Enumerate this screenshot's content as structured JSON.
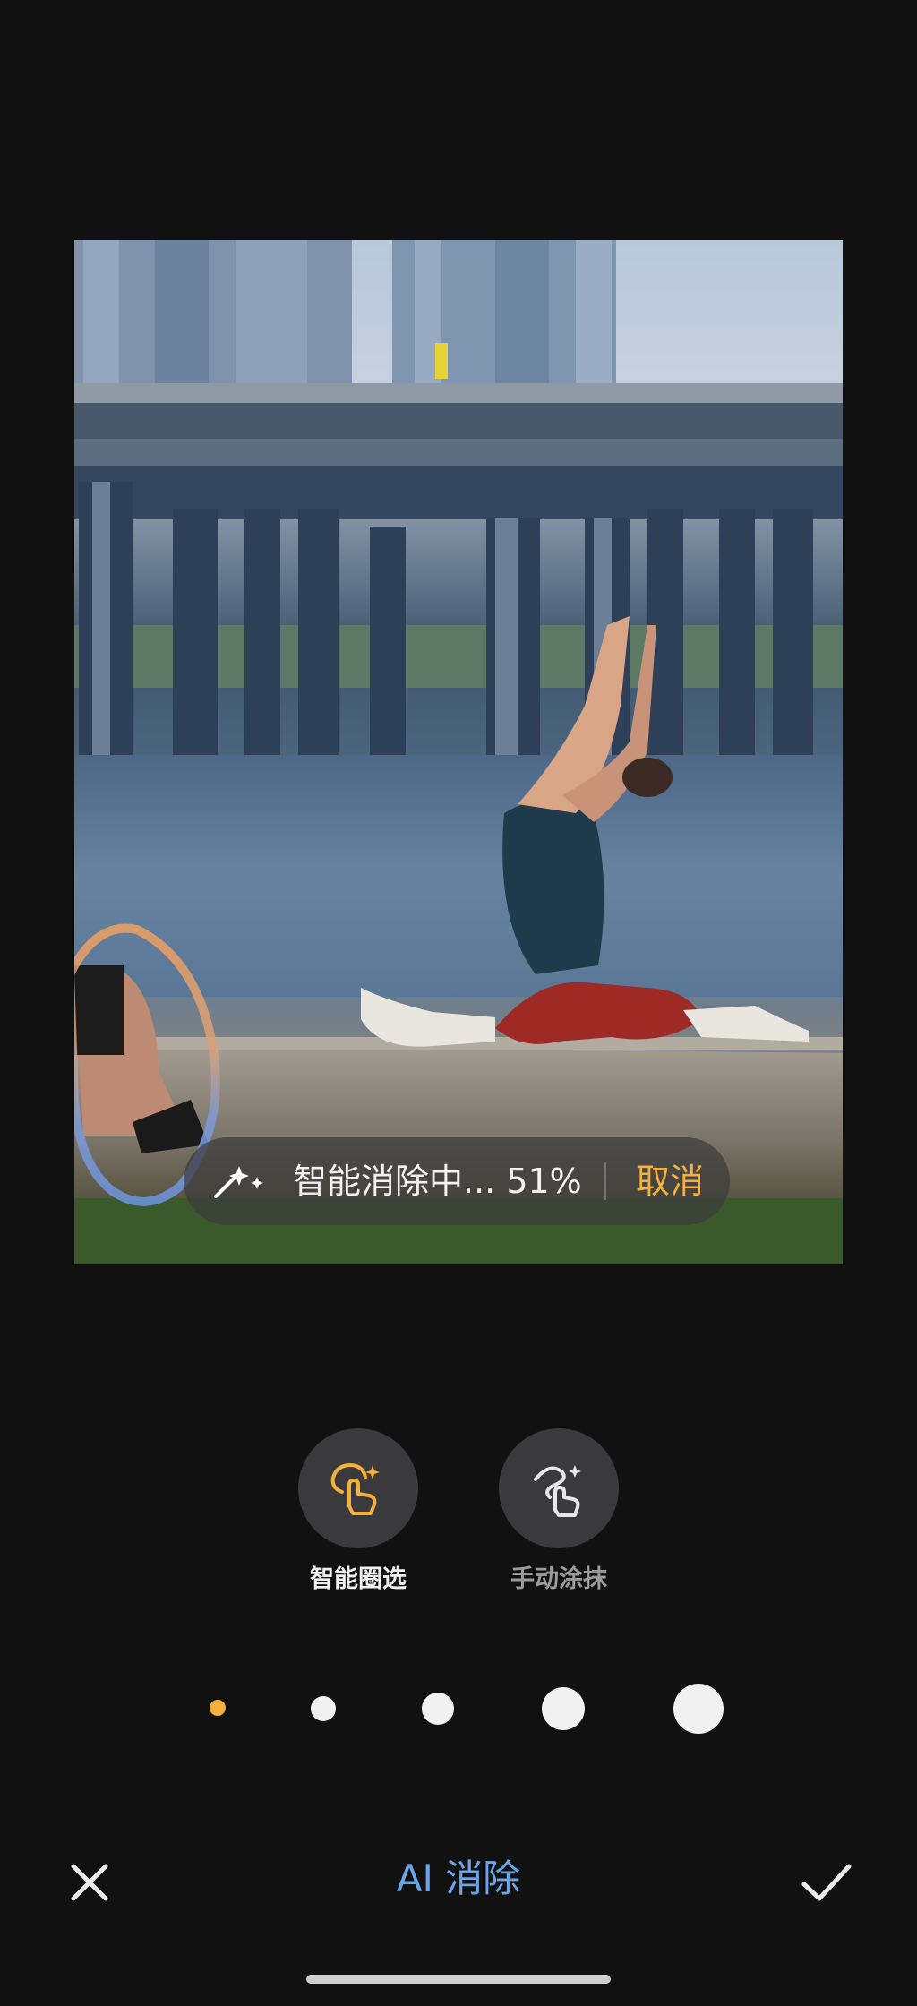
{
  "status": {
    "progress_text": "智能消除中... 51%",
    "progress_percent": 51,
    "cancel_label": "取消",
    "icon": "sparkle-icon"
  },
  "tools": [
    {
      "label": "智能圈选",
      "icon": "smart-select-icon",
      "active": true
    },
    {
      "label": "手动涂抹",
      "icon": "manual-brush-icon",
      "active": false
    }
  ],
  "brush_sizes": {
    "count": 5,
    "selected_index": 0
  },
  "bottom_bar": {
    "title": "AI 消除",
    "close_icon": "close-icon",
    "confirm_icon": "checkmark-icon"
  },
  "colors": {
    "accent": "#f5b13b",
    "title": "#6aa6e9",
    "background": "#111112"
  }
}
